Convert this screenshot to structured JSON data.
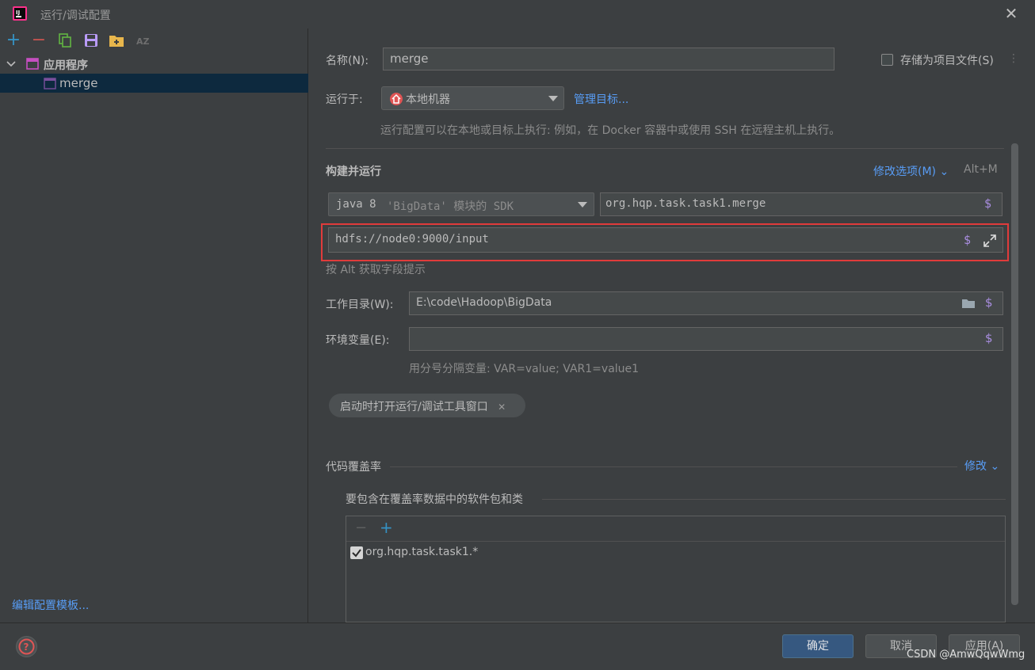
{
  "window": {
    "title": "运行/调试配置"
  },
  "tree": {
    "group_label": "应用程序",
    "item_label": "merge",
    "edit_templates": "编辑配置模板..."
  },
  "form": {
    "name_label": "名称(N):",
    "name_value": "merge",
    "store_label": "存储为项目文件(S)",
    "run_on_label": "运行于:",
    "run_on_value": "本地机器",
    "manage_targets": "管理目标...",
    "run_on_hint": "运行配置可以在本地或目标上执行: 例如，在 Docker 容器中或使用 SSH 在远程主机上执行。",
    "build_run_title": "构建并运行",
    "modify_options": "修改选项(M)",
    "modify_shortcut": "Alt+M",
    "sdk_java": "java 8",
    "sdk_rest": "'BigData' 模块的 SDK",
    "main_class": "org.hqp.task.task1.merge",
    "program_args": "hdfs://node0:9000/input",
    "alt_hint": "按 Alt 获取字段提示",
    "workdir_label": "工作目录(W):",
    "workdir_value": "E:\\code\\Hadoop\\BigData",
    "env_label": "环境变量(E):",
    "env_value": "",
    "env_hint": "用分号分隔变量: VAR=value; VAR1=value1",
    "chip_label": "启动时打开运行/调试工具窗口",
    "coverage_title": "代码覆盖率",
    "coverage_modify": "修改",
    "coverage_packages_title": "要包含在覆盖率数据中的软件包和类",
    "coverage_item": "org.hqp.task.task1.*"
  },
  "buttons": {
    "ok": "确定",
    "cancel": "取消",
    "apply": "应用(A)"
  },
  "watermark": "CSDN @AmwQqwWmg",
  "icons": {
    "dollar": "$",
    "close": "✕",
    "chip_close": "✕"
  }
}
